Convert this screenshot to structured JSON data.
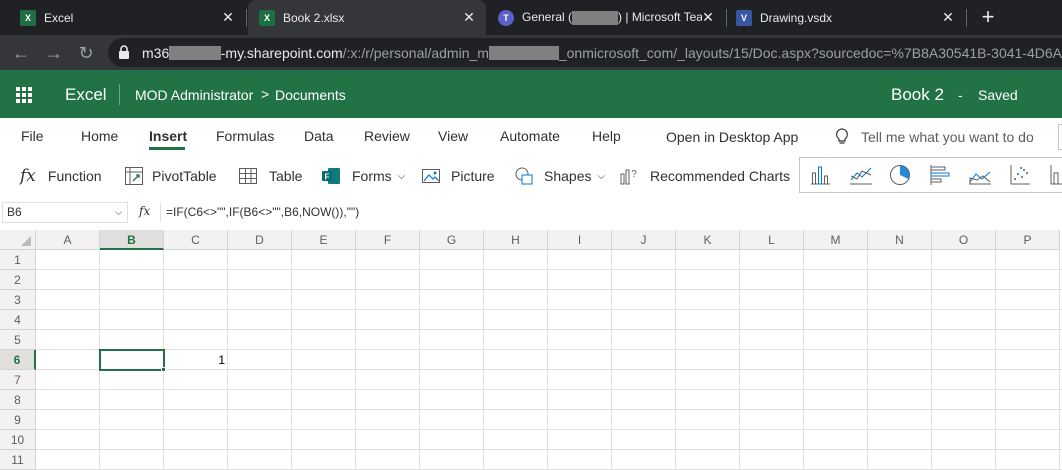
{
  "browser": {
    "tabs": [
      {
        "title": "Excel",
        "icon": "excel-icon",
        "active": false
      },
      {
        "title": "Book 2.xlsx",
        "icon": "excel-icon",
        "active": true
      },
      {
        "title_prefix": "General (",
        "title_suffix": ") | Microsoft Tea",
        "icon": "teams-icon",
        "active": false
      },
      {
        "title": "Drawing.vsdx",
        "icon": "visio-icon",
        "active": false
      }
    ],
    "new_tab": "+",
    "url_host_prefix": "m36",
    "url_host_suffix": "-my.sharepoint.com",
    "url_path_prefix": "/:x:/r/personal/admin_m",
    "url_path_suffix": "_onmicrosoft_com/_layouts/15/Doc.aspx?sourcedoc=%7B8A30541B-3041-4D6A"
  },
  "app": {
    "name": "Excel",
    "user": "MOD Administrator",
    "breadcrumb_sep": ">",
    "folder": "Documents",
    "doc_title": "Book 2",
    "dash": "-",
    "save_status": "Saved",
    "brand_color": "#217346"
  },
  "ribbon": {
    "tabs": [
      "File",
      "Home",
      "Insert",
      "Formulas",
      "Data",
      "Review",
      "View",
      "Automate",
      "Help"
    ],
    "active_tab": "Insert",
    "open_desktop": "Open in Desktop App",
    "tell_me": "Tell me what you want to do",
    "commands": {
      "function": "Function",
      "pivot": "PivotTable",
      "table": "Table",
      "forms": "Forms",
      "picture": "Picture",
      "shapes": "Shapes",
      "rec_charts": "Recommended Charts"
    }
  },
  "formula_bar": {
    "name_box": "B6",
    "fx": "fx",
    "formula": "=IF(C6<>\"\",IF(B6<>\"\",B6,NOW()),\"\")"
  },
  "sheet": {
    "columns": [
      "A",
      "B",
      "C",
      "D",
      "E",
      "F",
      "G",
      "H",
      "I",
      "J",
      "K",
      "L",
      "M",
      "N",
      "O",
      "P"
    ],
    "rows": [
      "1",
      "2",
      "3",
      "4",
      "5",
      "6",
      "7",
      "8",
      "9",
      "10",
      "11"
    ],
    "selected_cell": "B6",
    "cells": {
      "C6": "1"
    }
  }
}
